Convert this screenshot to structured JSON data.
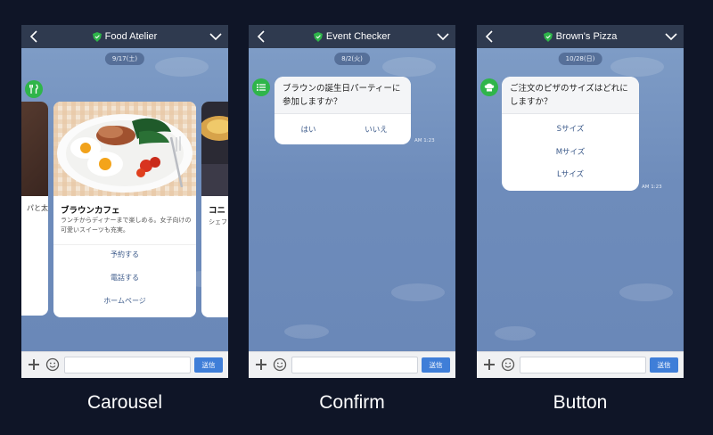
{
  "panels": {
    "carousel": {
      "chat_title": "Food Atelier",
      "date": "9/17(土)",
      "left_card_fragment": "パと太",
      "center_card": {
        "title": "ブラウンカフェ",
        "description": "ランチからディナーまで楽しめる。女子向けの可愛いスイーツも充実。",
        "actions": [
          "予約する",
          "電話する",
          "ホームページ"
        ]
      },
      "right_card_fragment": {
        "title": "コニ",
        "description": "シェフ"
      },
      "caption": "Carousel"
    },
    "confirm": {
      "chat_title": "Event Checker",
      "date": "8/2(火)",
      "question": "ブラウンの誕生日パーティーに参加しますか？",
      "options": [
        "はい",
        "いいえ"
      ],
      "timestamp": "AM 1:23",
      "caption": "Confirm"
    },
    "button": {
      "chat_title": "Brown's Pizza",
      "date": "10/28(日)",
      "question": "ご注文のピザのサイズはどれにしますか？",
      "options": [
        "Sサイズ",
        "Mサイズ",
        "Lサイズ"
      ],
      "timestamp": "AM 1:23",
      "caption": "Button"
    }
  },
  "input_bar": {
    "send_label": "送信"
  },
  "icons": {
    "back": "chevron-left-icon",
    "menu": "chevron-down-icon",
    "verified": "shield-icon",
    "add": "plus-icon",
    "emoji": "smiley-icon"
  },
  "colors": {
    "background": "#0f1527",
    "titlebar": "#2f3a4f",
    "chat_background": "#6f8fbd",
    "verified_green": "#2fb54a",
    "send_button": "#3f7ed8",
    "option_text": "#3c5a8a"
  }
}
